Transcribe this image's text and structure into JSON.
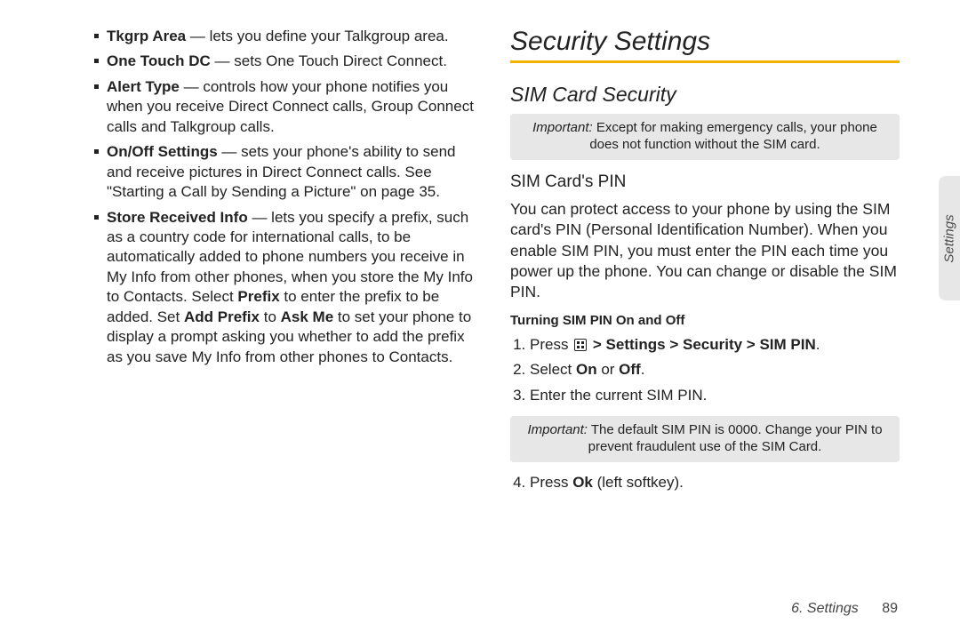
{
  "left": {
    "bullets": [
      {
        "term": "Tkgrp Area",
        "rest": " — lets you define your Talkgroup area."
      },
      {
        "term": "One Touch DC",
        "rest": " — sets One Touch Direct Connect."
      },
      {
        "term": "Alert Type",
        "rest": " — controls how your phone notifies you when you receive Direct Connect calls, Group Connect calls and Talkgroup calls."
      },
      {
        "term": "On/Off Settings",
        "rest": " — sets your phone's ability to send and receive pictures in Direct Connect calls. See \"Starting a Call by Sending a Picture\" on page 35."
      },
      {
        "term": "Store Received Info",
        "rest_html": " — lets you specify a prefix, such as a country code for international calls, to be automatically added to phone numbers you receive in My Info from other phones, when you store the My Info to Contacts. Select <span class=\"bold\">Prefix</span> to enter the prefix to be added. Set <span class=\"bold\">Add Prefix</span> to <span class=\"bold\">Ask Me</span> to set your phone to display a prompt asking you whether to add the prefix as you save My Info from other phones to Contacts."
      }
    ]
  },
  "right": {
    "h1": "Security Settings",
    "h2": "SIM Card Security",
    "important1": {
      "label": "Important:",
      "text": "Except for making emergency calls, your phone does not function without the SIM card."
    },
    "h3": "SIM Card's PIN",
    "body1": "You can protect access to your phone by using the SIM card's PIN (Personal Identification Number). When you enable SIM PIN, you must enter the PIN each time you power up the phone. You can change or disable the SIM PIN.",
    "sub1": "Turning SIM PIN On and Off",
    "step1_pre": "Press ",
    "step1_path": " > Settings > Security > SIM PIN",
    "step1_end": ".",
    "step2_pre": "Select ",
    "step2_on": "On",
    "step2_or": " or ",
    "step2_off": "Off",
    "step2_end": ".",
    "step3": "Enter the current SIM PIN.",
    "important2": {
      "label": "Important:",
      "text": "The default SIM PIN is 0000. Change your PIN to prevent fraudulent use of the SIM Card."
    },
    "step4_pre": "Press ",
    "step4_ok": "Ok",
    "step4_end": " (left softkey)."
  },
  "sideTab": "Settings",
  "footer": {
    "chapter": "6. Settings",
    "page": "89"
  }
}
